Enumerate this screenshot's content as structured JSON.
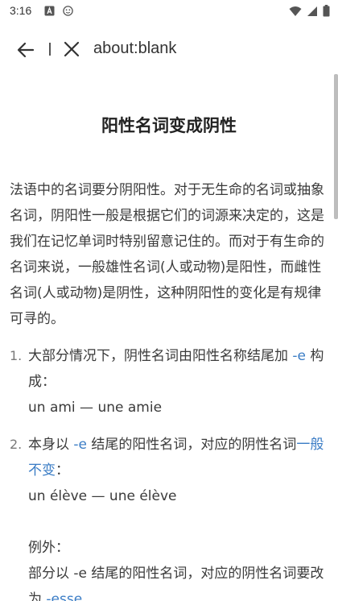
{
  "status_bar": {
    "time": "3:16",
    "app_icons": [
      "a-box-icon",
      "face-icon"
    ],
    "right_icons": [
      "wifi-icon",
      "signal-icon",
      "battery-icon"
    ]
  },
  "toolbar": {
    "url": "about:blank"
  },
  "article": {
    "title": "阳性名词变成阴性",
    "intro": "法语中的名词要分阴阳性。对于无生命的名词或抽象名词，阴阳性一般是根据它们的词源来决定的，这是我们在记忆单词时特别留意记住的。而对于有生命的名词来说，一般雄性名词(人或动物)是阳性，而雌性名词(人或动物)是阴性，这种阴阳性的变化是有规律可寻的。",
    "items": [
      {
        "number": "1.",
        "text_before": "大部分情况下，阴性名词由阳性名称结尾加 ",
        "highlight": "-e",
        "text_after": " 构成：",
        "example": "un ami — une amie"
      },
      {
        "number": "2.",
        "text_before": "本身以 ",
        "highlight": "-e",
        "text_mid": " 结尾的阳性名词，对应的阴性名词",
        "highlight2": "一般不变",
        "text_after": "：",
        "example": "un élève — une élève",
        "exception_label": "例外：",
        "exception_text_before": "部分以 -e 结尾的阳性名词，对应的阴性名词要改为 ",
        "exception_highlight": "-esse"
      }
    ]
  }
}
